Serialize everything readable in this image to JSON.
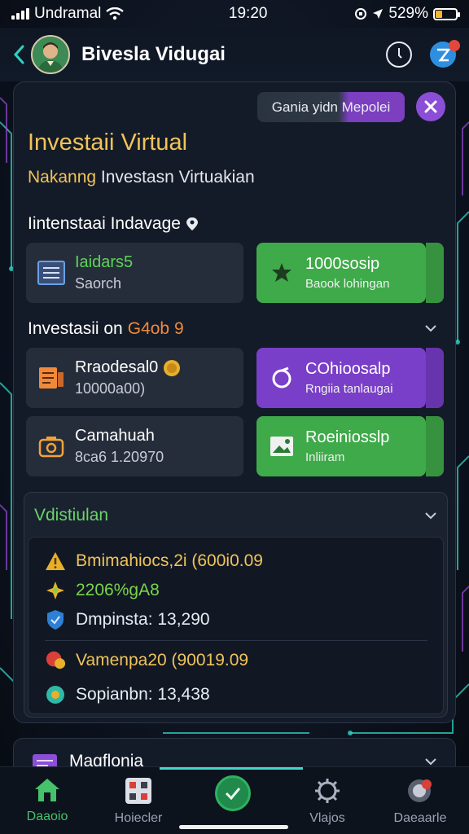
{
  "status_bar": {
    "carrier": "Undramal",
    "time": "19:20",
    "battery": "529%"
  },
  "header": {
    "title": "Bivesla Vidugai"
  },
  "main": {
    "chip": "Gania yidn Mepolei",
    "title": "Investaii Virtual",
    "subtitle_highlight": "Nakanng",
    "subtitle_rest": " Investasn Virtuakian",
    "section1": {
      "label": "Iintenstaai Indavage"
    },
    "tiles_row1": [
      {
        "title": "Iaidars5",
        "sub": "Saorch",
        "style": "dark"
      },
      {
        "title": "1000sosip",
        "sub": "Baook lohingan",
        "style": "green"
      }
    ],
    "section2": {
      "label": "Investasii on",
      "accent": "G4ob 9"
    },
    "tiles_row2": [
      {
        "title": "Rraodesal0",
        "sub": "10000a00)",
        "style": "dark"
      },
      {
        "title": "COhioosalp",
        "sub": "Rngiia tanlaugai",
        "style": "purple"
      }
    ],
    "tiles_row3": [
      {
        "title": "Camahuah",
        "sub": "8ca6 1.20970",
        "style": "dark"
      },
      {
        "title": "Roeiniosslp",
        "sub": "Inliiram",
        "style": "green"
      }
    ]
  },
  "panel": {
    "title": "Vdistiulan",
    "stats": [
      {
        "text": "Bmimahiocs,2i (600i0.09",
        "color": "#f0c35a"
      },
      {
        "text": "2206%gA8",
        "color": "#7bd34a"
      },
      {
        "text": "Dmpinsta: 13,290",
        "color": "#e8ebf2"
      },
      {
        "text": "Vamenpa20 (90019.09",
        "color": "#f0c35a"
      },
      {
        "text": "Sopianbn: 13,438",
        "color": "#e8ebf2"
      }
    ]
  },
  "card2": {
    "title": "Magflonia"
  },
  "nav": {
    "items": [
      {
        "label": "Daaoio",
        "icon": "home-icon"
      },
      {
        "label": "Hoiecler",
        "icon": "grid-icon"
      },
      {
        "label": "Vlajos",
        "icon": "gear-icon"
      },
      {
        "label": "Daeaarle",
        "icon": "settings-globe-icon"
      }
    ]
  },
  "colors": {
    "accent_green": "#3faa4a",
    "accent_purple": "#7a3fc8",
    "accent_gold": "#f0c35a",
    "background": "#0b111c"
  }
}
